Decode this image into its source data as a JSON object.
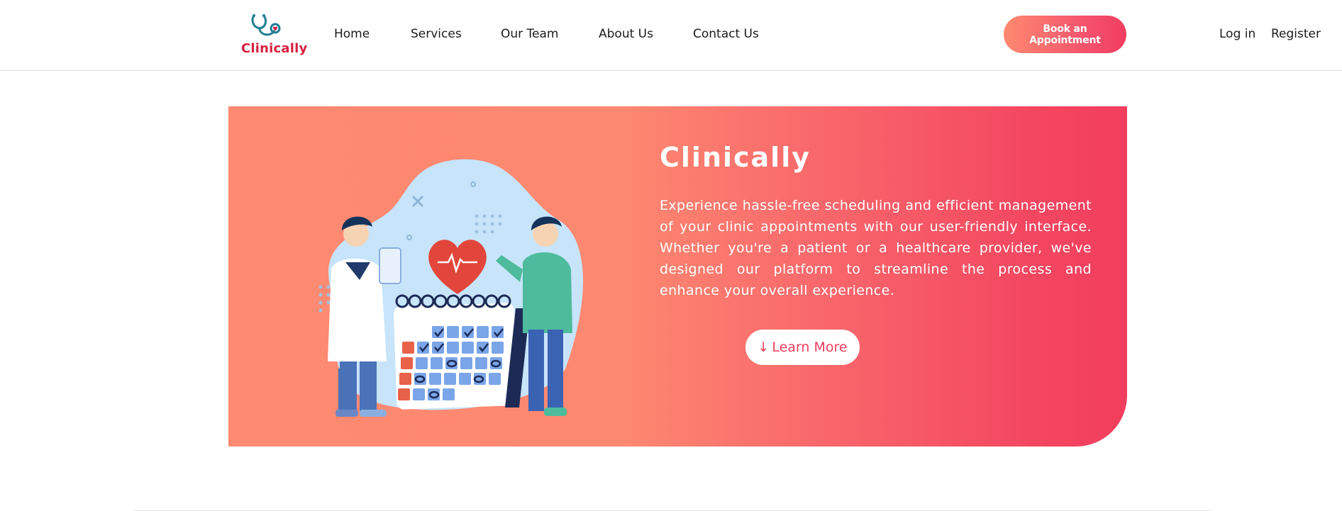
{
  "brand": {
    "name": "Clinically",
    "accent": "#d8203f"
  },
  "nav": {
    "items": [
      {
        "label": "Home"
      },
      {
        "label": "Services"
      },
      {
        "label": "Our Team"
      },
      {
        "label": "About Us"
      },
      {
        "label": "Contact Us"
      }
    ],
    "cta_label": "Book an Appointment",
    "login_label": "Log in",
    "register_label": "Register"
  },
  "hero": {
    "title": "Clinically",
    "description": "Experience hassle-free scheduling and efficient management of your clinic appointments with our user-friendly interface. Whether you're a patient or a healthcare provider, we've designed our platform to streamline the process and enhance your overall experience.",
    "learn_more_label": "Learn More",
    "learn_more_icon": "arrow-down-icon",
    "gradient_start": "#fe8a71",
    "gradient_end": "#f23e5e",
    "illustration": "doctor-patient-calendar-illustration"
  }
}
